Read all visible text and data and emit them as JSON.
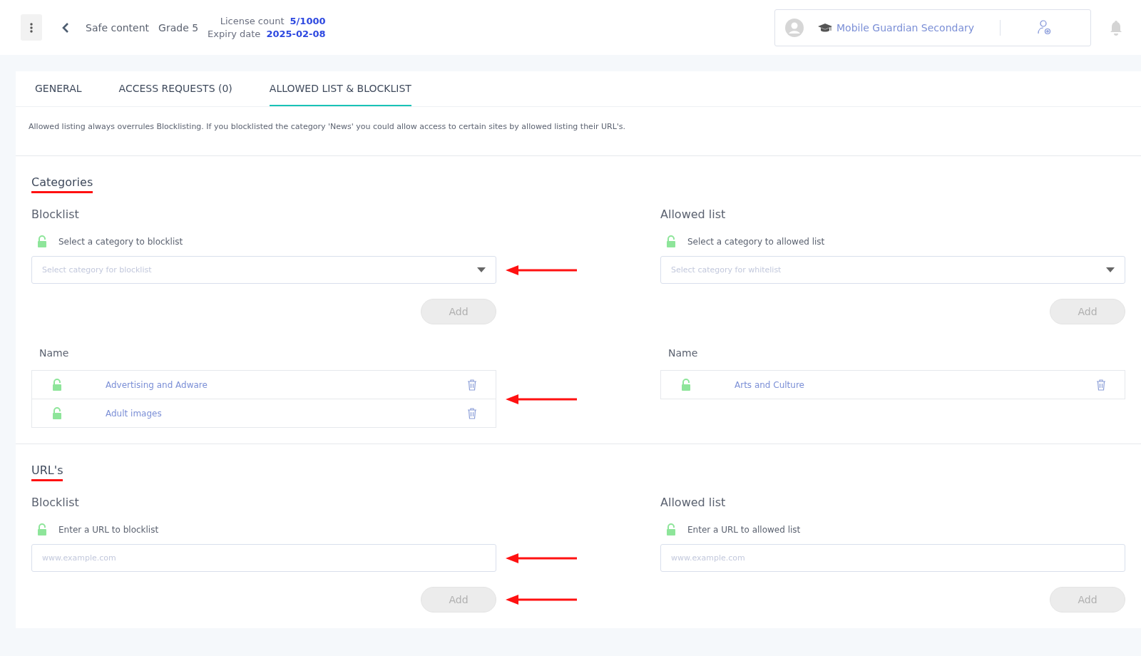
{
  "header": {
    "breadcrumbs": [
      "Safe content",
      "Grade 5"
    ],
    "license": {
      "label": "License count",
      "value": "5/1000"
    },
    "expiry": {
      "label": "Expiry date",
      "value": "2025-02-08"
    },
    "account": {
      "name": "Mobile Guardian Secondary"
    }
  },
  "tabs": [
    {
      "label": "GENERAL",
      "selected": false
    },
    {
      "label": "ACCESS REQUESTS (0)",
      "selected": false
    },
    {
      "label": "ALLOWED LIST & BLOCKLIST",
      "selected": true
    }
  ],
  "description": "Allowed listing always overrules Blocklisting. If you blocklisted the category 'News' you could allow access to certain sites by allowed listing their URL's.",
  "sections": [
    {
      "title": "Categories",
      "kind": "categories",
      "columns": [
        {
          "heading": "Blocklist",
          "label": "Select a category to blocklist",
          "placeholder": "Select category for blocklist",
          "button": "Add",
          "field_annotated": true,
          "button_annotated": false,
          "table_heading": "Name",
          "table_annotated": true,
          "rows": [
            {
              "name": "Advertising and Adware"
            },
            {
              "name": "Adult images"
            }
          ]
        },
        {
          "heading": "Allowed list",
          "label": "Select a category to allowed list",
          "placeholder": "Select category for whitelist",
          "button": "Add",
          "field_annotated": false,
          "button_annotated": false,
          "table_heading": "Name",
          "table_annotated": false,
          "rows": [
            {
              "name": "Arts and Culture"
            }
          ]
        }
      ]
    },
    {
      "title": "URL's",
      "kind": "urls",
      "columns": [
        {
          "heading": "Blocklist",
          "label": "Enter a URL to blocklist",
          "placeholder": "www.example.com",
          "button": "Add",
          "field_annotated": true,
          "button_annotated": true
        },
        {
          "heading": "Allowed list",
          "label": "Enter a URL to allowed list",
          "placeholder": "www.example.com",
          "button": "Add",
          "field_annotated": false,
          "button_annotated": false
        }
      ]
    }
  ]
}
